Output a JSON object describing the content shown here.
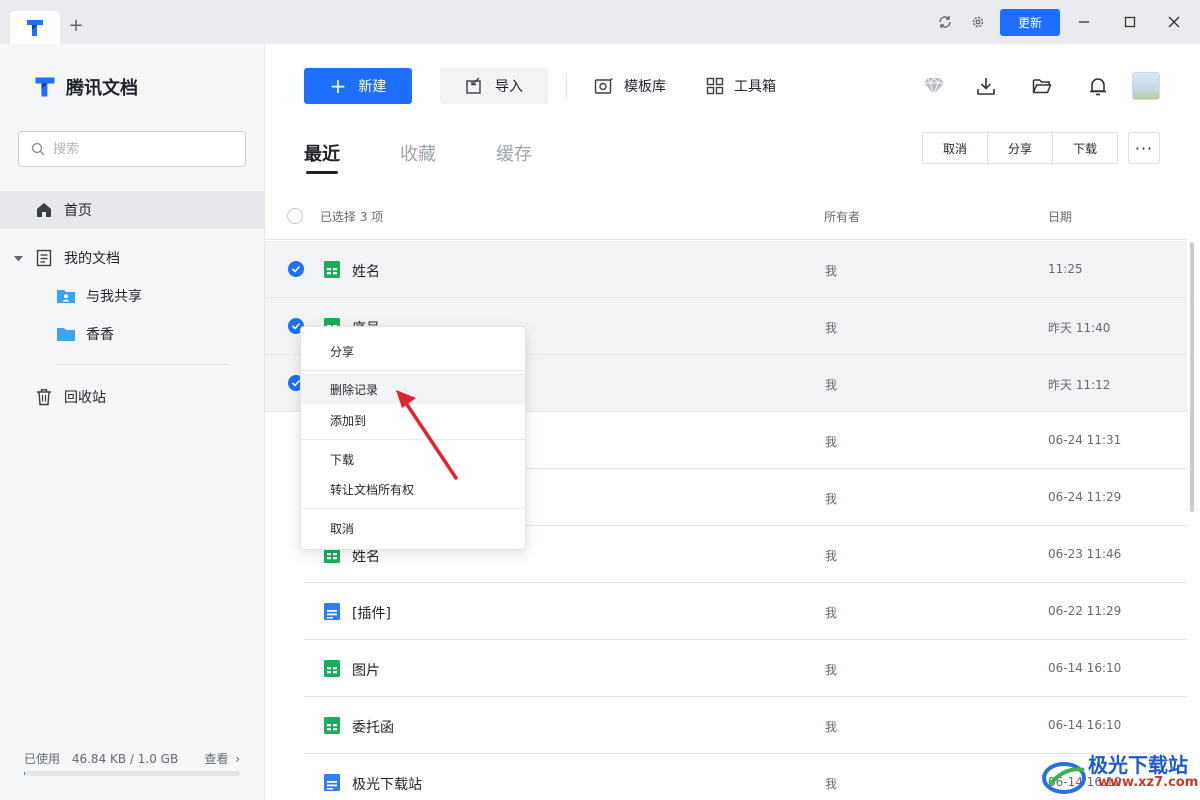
{
  "titlebar": {
    "update_label": "更新"
  },
  "sidebar": {
    "brand": "腾讯文档",
    "search_placeholder": "搜索",
    "nav": {
      "home": "首页",
      "my_docs": "我的文档",
      "shared_with_me": "与我共享",
      "folder_xiangxiang": "香香",
      "recycle_bin": "回收站"
    },
    "storage": {
      "used_label": "已使用",
      "usage": "46.84 KB / 1.0 GB",
      "view_label": "查看",
      "used_fraction": 4e-05
    }
  },
  "toolbar": {
    "new_label": "新建",
    "import_label": "导入",
    "templates_label": "模板库",
    "toolbox_label": "工具箱"
  },
  "tabs": [
    "最近",
    "收藏",
    "缓存"
  ],
  "actions": {
    "cancel": "取消",
    "share": "分享",
    "download": "下载",
    "more": "···"
  },
  "list": {
    "selected_text": "已选择 3 项",
    "col_owner": "所有者",
    "col_date": "日期",
    "rows": [
      {
        "name": "姓名",
        "owner": "我",
        "date": "11:25",
        "type": "sheet",
        "checked": true
      },
      {
        "name": "序号",
        "owner": "我",
        "date": "昨天 11:40",
        "type": "sheet",
        "checked": true
      },
      {
        "name": "",
        "owner": "我",
        "date": "昨天 11:12",
        "type": "sheet",
        "checked": true
      },
      {
        "name": "",
        "owner": "我",
        "date": "06-24 11:31",
        "type": "sheet",
        "checked": false
      },
      {
        "name": "",
        "owner": "我",
        "date": "06-24 11:29",
        "type": "sheet",
        "checked": false
      },
      {
        "name": "姓名",
        "owner": "我",
        "date": "06-23 11:46",
        "type": "sheet",
        "checked": false
      },
      {
        "name": "[插件]",
        "owner": "我",
        "date": "06-22 11:29",
        "type": "doc",
        "checked": false
      },
      {
        "name": "图片",
        "owner": "我",
        "date": "06-14 16:10",
        "type": "sheet",
        "checked": false
      },
      {
        "name": "委托函",
        "owner": "我",
        "date": "06-14 16:10",
        "type": "sheet",
        "checked": false
      },
      {
        "name": "极光下载站",
        "owner": "我",
        "date": "06-14 16:10",
        "type": "doc",
        "checked": false
      }
    ]
  },
  "context_menu": {
    "share": "分享",
    "delete_record": "删除记录",
    "add_to": "添加到",
    "download": "下载",
    "transfer_ownership": "转让文档所有权",
    "cancel": "取消"
  },
  "watermark": {
    "name": "极光下载站",
    "url": "www.xz7.com"
  },
  "colors": {
    "accent": "#1f6fff",
    "sheet_icon": "#1aad5a",
    "doc_icon": "#2f7cf6",
    "annotation_arrow": "#e0242b"
  }
}
